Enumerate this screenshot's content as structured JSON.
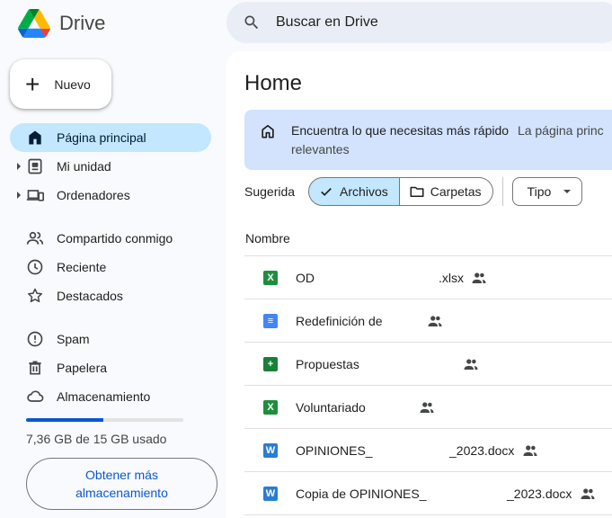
{
  "app": {
    "name": "Drive"
  },
  "search": {
    "placeholder": "Buscar en Drive"
  },
  "new_button": {
    "label": "Nuevo"
  },
  "sidebar": {
    "items": [
      {
        "label": "Página principal",
        "icon": "home-icon",
        "active": true
      },
      {
        "label": "Mi unidad",
        "icon": "my-drive-icon"
      },
      {
        "label": "Ordenadores",
        "icon": "computers-icon"
      },
      {
        "label": "Compartido conmigo",
        "icon": "shared-icon"
      },
      {
        "label": "Reciente",
        "icon": "clock-icon"
      },
      {
        "label": "Destacados",
        "icon": "star-icon"
      },
      {
        "label": "Spam",
        "icon": "spam-icon"
      },
      {
        "label": "Papelera",
        "icon": "trash-icon"
      },
      {
        "label": "Almacenamiento",
        "icon": "cloud-icon"
      }
    ],
    "storage": {
      "text": "7,36 GB de 15 GB usado",
      "used_fraction": 0.49
    },
    "get_more": "Obtener más almacenamiento"
  },
  "main": {
    "title": "Home",
    "banner": {
      "heading": "Encuentra lo que necesitas más rápido",
      "text_start": "La página princ",
      "text_cont": "relevantes"
    },
    "filters": {
      "suggested": "Sugerida",
      "files": "Archivos",
      "folders": "Carpetas",
      "type": "Tipo"
    },
    "column_name": "Nombre",
    "files": [
      {
        "icon": "excel",
        "name": "OD",
        "suffix": ".xlsx"
      },
      {
        "icon": "doc",
        "name": "Redefinición de",
        "suffix": ""
      },
      {
        "icon": "sheet",
        "name": "Propuestas",
        "suffix": ""
      },
      {
        "icon": "excel",
        "name": "Voluntariado",
        "suffix": ""
      },
      {
        "icon": "word",
        "name": "OPINIONES_",
        "suffix": "_2023.docx"
      },
      {
        "icon": "word",
        "name": "Copia de OPINIONES_",
        "suffix": "_2023.docx"
      }
    ]
  },
  "colors": {
    "accent": "#0b57d0",
    "active_bg": "#c2e7ff",
    "banner_bg": "#d3e3fd",
    "page_bg": "#f8fafd"
  }
}
